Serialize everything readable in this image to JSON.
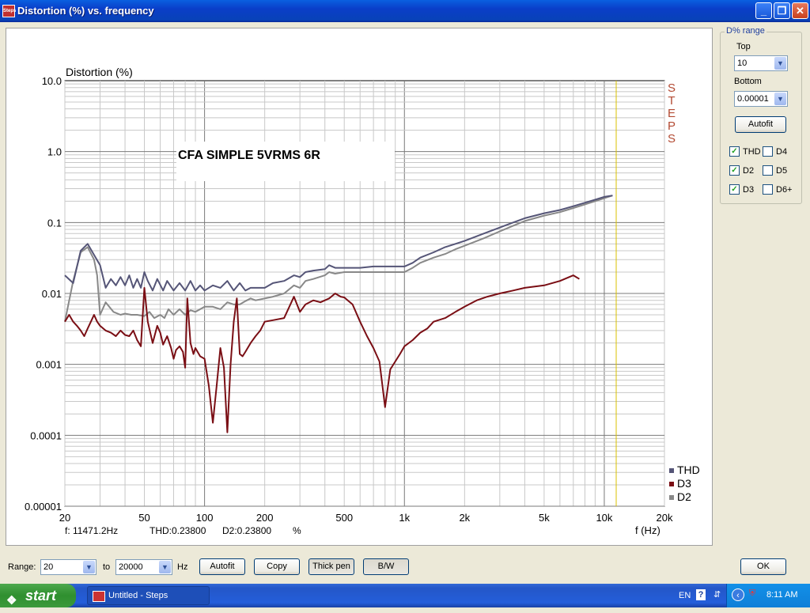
{
  "window": {
    "title": "Distortion (%) vs. frequency",
    "app_icon_text": "Steps"
  },
  "chart_panel": {
    "overlay_text": "CFA SIMPLE 5VRMS 6R",
    "brand_vertical": "STEPS",
    "readout": {
      "freq": "f:  11471.2Hz",
      "thd": "THD:0.23800",
      "d2": "D2:0.23800",
      "unit": "%"
    }
  },
  "options": {
    "group_title": "D% range",
    "top_label": "Top",
    "top_value": "10",
    "bottom_label": "Bottom",
    "bottom_value": "0.00001",
    "autofit_label": "Autofit",
    "checkboxes": [
      {
        "label": "THD",
        "checked": true
      },
      {
        "label": "D4",
        "checked": false
      },
      {
        "label": "D2",
        "checked": true
      },
      {
        "label": "D5",
        "checked": false
      },
      {
        "label": "D3",
        "checked": true
      },
      {
        "label": "D6+",
        "checked": false
      }
    ]
  },
  "bottom_bar": {
    "range_label": "Range:",
    "range_from": "20",
    "to_label": "to",
    "range_to": "20000",
    "hz_label": "Hz",
    "autofit_button": "Autofit",
    "copy_button": "Copy",
    "thickpen_button": "Thick pen",
    "bw_button": "B/W",
    "ok_button": "OK"
  },
  "taskbar": {
    "start_label": "start",
    "task_label": "Untitled - Steps",
    "lang": "EN",
    "clock": "8:11 AM"
  },
  "colors": {
    "thd": "#555577",
    "d3": "#7a0e14",
    "d2": "#888888",
    "cursor": "#d8c000",
    "grid": "#c8c8c8"
  },
  "chart_data": {
    "type": "line",
    "title": "",
    "ylabel": "Distortion (%)",
    "xlabel": "f (Hz)",
    "x_scale": "log",
    "y_scale": "log",
    "xlim": [
      20,
      20000
    ],
    "ylim": [
      1e-05,
      10
    ],
    "x_ticks": [
      20,
      50,
      100,
      200,
      500,
      1000,
      2000,
      5000,
      10000,
      20000
    ],
    "x_tick_labels": [
      "20",
      "50",
      "100",
      "200",
      "500",
      "1k",
      "2k",
      "5k",
      "10k",
      "20k"
    ],
    "y_ticks": [
      1e-05,
      0.0001,
      0.001,
      0.01,
      0.1,
      1,
      10
    ],
    "y_tick_labels": [
      "0.00001",
      "0.0001",
      "0.001",
      "0.01",
      "0.1",
      "1.0",
      "10.0"
    ],
    "grid": true,
    "legend_position": "bottom-right",
    "cursor_x": 11471.2,
    "series": [
      {
        "name": "THD",
        "x": [
          20,
          22,
          24,
          26,
          28,
          30,
          32,
          34,
          36,
          38,
          40,
          42,
          44,
          46,
          48,
          50,
          52,
          55,
          58,
          62,
          65,
          70,
          75,
          80,
          85,
          90,
          95,
          100,
          110,
          120,
          130,
          140,
          150,
          160,
          170,
          180,
          200,
          220,
          250,
          280,
          300,
          320,
          350,
          400,
          420,
          450,
          500,
          600,
          700,
          800,
          900,
          1000,
          1100,
          1200,
          1400,
          1600,
          1800,
          2000,
          2500,
          3000,
          3500,
          4000,
          5000,
          6000,
          7000,
          8000,
          9000,
          10000,
          11000
        ],
        "y": [
          0.018,
          0.014,
          0.04,
          0.05,
          0.035,
          0.025,
          0.012,
          0.016,
          0.013,
          0.017,
          0.013,
          0.018,
          0.012,
          0.016,
          0.012,
          0.02,
          0.015,
          0.011,
          0.016,
          0.011,
          0.015,
          0.011,
          0.014,
          0.011,
          0.015,
          0.011,
          0.013,
          0.011,
          0.013,
          0.012,
          0.015,
          0.011,
          0.014,
          0.011,
          0.012,
          0.012,
          0.012,
          0.014,
          0.015,
          0.018,
          0.017,
          0.02,
          0.021,
          0.022,
          0.025,
          0.023,
          0.023,
          0.023,
          0.024,
          0.024,
          0.024,
          0.024,
          0.027,
          0.032,
          0.038,
          0.045,
          0.05,
          0.055,
          0.07,
          0.085,
          0.1,
          0.115,
          0.135,
          0.15,
          0.17,
          0.19,
          0.21,
          0.23,
          0.24
        ]
      },
      {
        "name": "D3",
        "x": [
          20,
          21,
          22,
          23,
          24,
          25,
          26,
          27,
          28,
          29,
          30,
          32,
          34,
          36,
          38,
          40,
          42,
          44,
          46,
          48,
          50,
          52,
          55,
          58,
          60,
          62,
          65,
          68,
          70,
          72,
          75,
          78,
          80,
          82,
          85,
          88,
          90,
          95,
          100,
          105,
          110,
          115,
          120,
          125,
          130,
          135,
          140,
          145,
          150,
          155,
          160,
          170,
          180,
          190,
          200,
          220,
          250,
          280,
          300,
          320,
          350,
          380,
          400,
          420,
          450,
          480,
          500,
          550,
          600,
          650,
          700,
          750,
          800,
          850,
          900,
          950,
          1000,
          1100,
          1200,
          1300,
          1400,
          1600,
          1800,
          2000,
          2300,
          2600,
          3000,
          3500,
          4000,
          5000,
          6000,
          7000,
          7500
        ],
        "y": [
          0.004,
          0.005,
          0.004,
          0.0035,
          0.003,
          0.0025,
          0.0032,
          0.004,
          0.005,
          0.004,
          0.0035,
          0.003,
          0.0028,
          0.0025,
          0.003,
          0.0026,
          0.0025,
          0.003,
          0.0022,
          0.0018,
          0.012,
          0.004,
          0.002,
          0.0035,
          0.0028,
          0.0019,
          0.0025,
          0.0017,
          0.0012,
          0.0016,
          0.0018,
          0.0015,
          0.0009,
          0.0085,
          0.002,
          0.0014,
          0.0017,
          0.0013,
          0.0012,
          0.0005,
          0.00015,
          0.0005,
          0.0017,
          0.0009,
          0.00011,
          0.001,
          0.004,
          0.0085,
          0.0014,
          0.0013,
          0.0015,
          0.002,
          0.0025,
          0.003,
          0.004,
          0.0042,
          0.0045,
          0.009,
          0.0055,
          0.007,
          0.008,
          0.0075,
          0.008,
          0.0085,
          0.01,
          0.009,
          0.0088,
          0.007,
          0.004,
          0.0025,
          0.0017,
          0.0011,
          0.00025,
          0.00085,
          0.0011,
          0.0014,
          0.0018,
          0.0022,
          0.0028,
          0.0032,
          0.004,
          0.0045,
          0.0055,
          0.0065,
          0.008,
          0.009,
          0.01,
          0.011,
          0.012,
          0.013,
          0.015,
          0.018,
          0.016
        ]
      },
      {
        "name": "D2",
        "x": [
          20,
          22,
          24,
          26,
          28,
          29,
          30,
          32,
          35,
          38,
          40,
          43,
          46,
          50,
          53,
          56,
          60,
          63,
          66,
          70,
          75,
          80,
          85,
          90,
          100,
          110,
          120,
          130,
          140,
          150,
          160,
          170,
          180,
          200,
          220,
          250,
          280,
          300,
          320,
          350,
          400,
          420,
          450,
          500,
          600,
          700,
          800,
          900,
          1000,
          1100,
          1200,
          1400,
          1600,
          1800,
          2000,
          2500,
          3000,
          3500,
          4000,
          5000,
          6000,
          7000,
          8000,
          9000,
          10000,
          11000
        ],
        "y": [
          0.004,
          0.015,
          0.038,
          0.045,
          0.03,
          0.018,
          0.005,
          0.0075,
          0.0055,
          0.005,
          0.0052,
          0.005,
          0.005,
          0.0048,
          0.0055,
          0.0045,
          0.005,
          0.0045,
          0.006,
          0.005,
          0.006,
          0.005,
          0.0058,
          0.0055,
          0.0065,
          0.0065,
          0.006,
          0.0075,
          0.007,
          0.007,
          0.0078,
          0.0085,
          0.008,
          0.0085,
          0.009,
          0.01,
          0.013,
          0.012,
          0.015,
          0.016,
          0.018,
          0.02,
          0.019,
          0.02,
          0.02,
          0.02,
          0.02,
          0.02,
          0.02,
          0.023,
          0.027,
          0.032,
          0.036,
          0.042,
          0.047,
          0.06,
          0.075,
          0.09,
          0.105,
          0.125,
          0.14,
          0.16,
          0.18,
          0.2,
          0.22,
          0.24
        ]
      }
    ]
  }
}
